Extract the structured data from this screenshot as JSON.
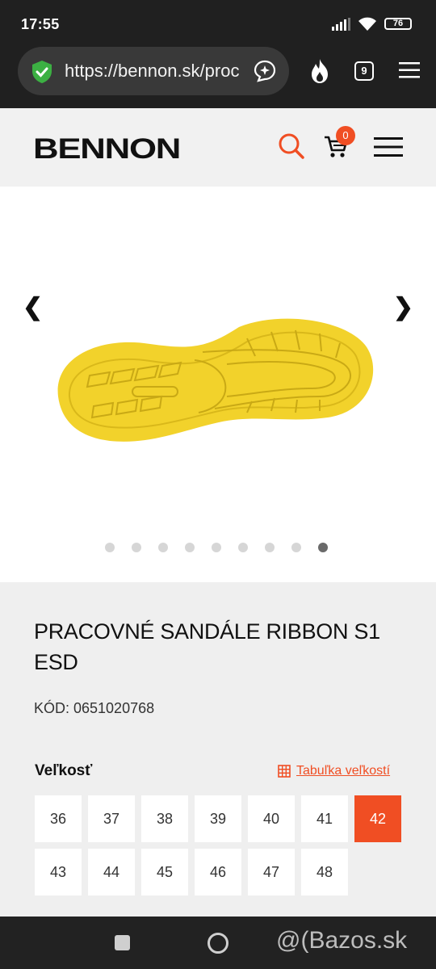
{
  "status": {
    "time": "17:55",
    "battery": "76"
  },
  "browser": {
    "url": "https://bennon.sk/proc",
    "tab_count": "9"
  },
  "site": {
    "logo": "BENNON",
    "cart_count": "0"
  },
  "gallery": {
    "prev": "❮",
    "next": "❯",
    "dot_count": 9,
    "active_dot": 9
  },
  "product": {
    "title": "PRACOVNÉ SANDÁLE RIBBON S1 ESD",
    "code": "KÓD: 0651020768",
    "size_label": "Veľkosť",
    "size_table_link": "Tabuľka veľkostí",
    "sizes": [
      "36",
      "37",
      "38",
      "39",
      "40",
      "41",
      "42",
      "43",
      "44",
      "45",
      "46",
      "47",
      "48"
    ],
    "selected_size": "42"
  },
  "watermark": "@(Bazos.sk",
  "colors": {
    "accent": "#f04e23",
    "sole": "#f2d22b",
    "dark": "#202020"
  }
}
